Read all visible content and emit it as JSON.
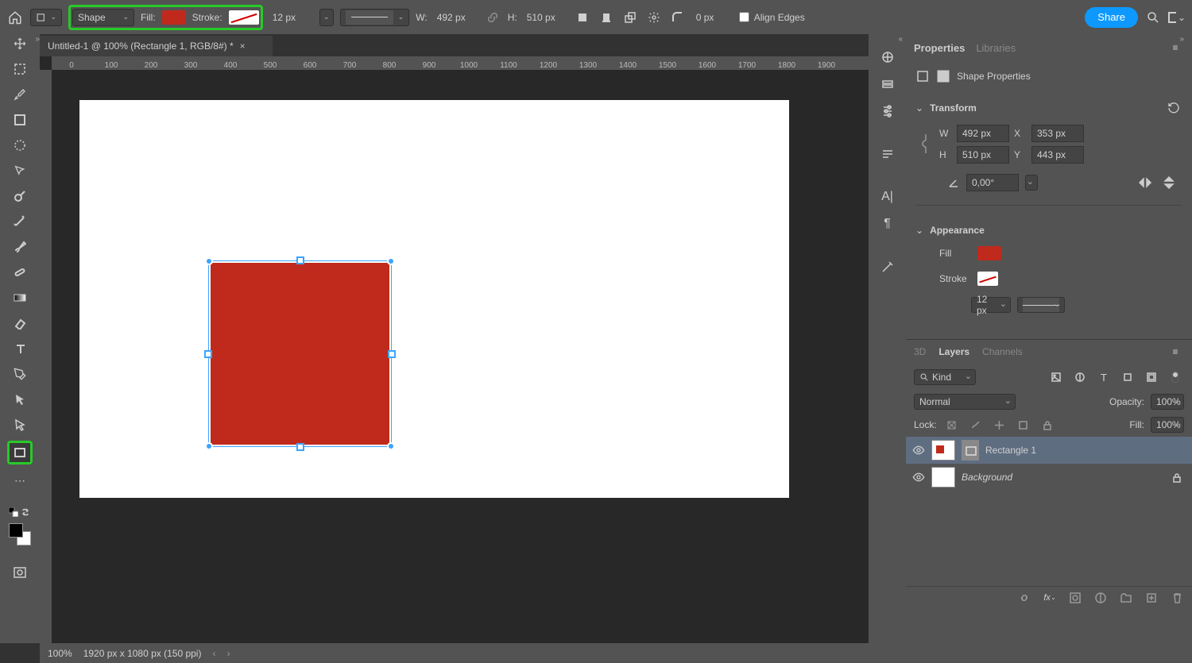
{
  "optbar": {
    "mode": "Shape",
    "fill_label": "Fill:",
    "stroke_label": "Stroke:",
    "stroke_width": "12 px",
    "w_label": "W:",
    "w": "492 px",
    "h_label": "H:",
    "h": "510 px",
    "radius": "0 px",
    "align_edges": "Align Edges",
    "share": "Share"
  },
  "fill_color": "#bf2a1c",
  "doc": {
    "tab": "Untitled-1 @ 100% (Rectangle 1, RGB/8#) *"
  },
  "status": {
    "zoom": "100%",
    "dims": "1920 px x 1080 px (150 ppi)"
  },
  "ruler_h": [
    "0",
    "100",
    "200",
    "300",
    "400",
    "500",
    "600",
    "700",
    "800",
    "900",
    "1000",
    "1100",
    "1200",
    "1300",
    "1400",
    "1500",
    "1600",
    "1700",
    "1800",
    "1900"
  ],
  "props": {
    "panel_tab1": "Properties",
    "panel_tab2": "Libraries",
    "title": "Shape Properties",
    "transform": "Transform",
    "W": "W",
    "w": "492 px",
    "X": "X",
    "x": "353 px",
    "H": "H",
    "h": "510 px",
    "Y": "Y",
    "y": "443 px",
    "angle": "0,00°",
    "appearance": "Appearance",
    "fill": "Fill",
    "stroke": "Stroke",
    "stroke_w": "12 px"
  },
  "layers": {
    "tab_3d": "3D",
    "tab_layers": "Layers",
    "tab_channels": "Channels",
    "kind": "Kind",
    "blend": "Normal",
    "opacity_l": "Opacity:",
    "opacity": "100%",
    "lock": "Lock:",
    "fill_l": "Fill:",
    "fill_v": "100%",
    "row1": "Rectangle 1",
    "row2": "Background"
  }
}
